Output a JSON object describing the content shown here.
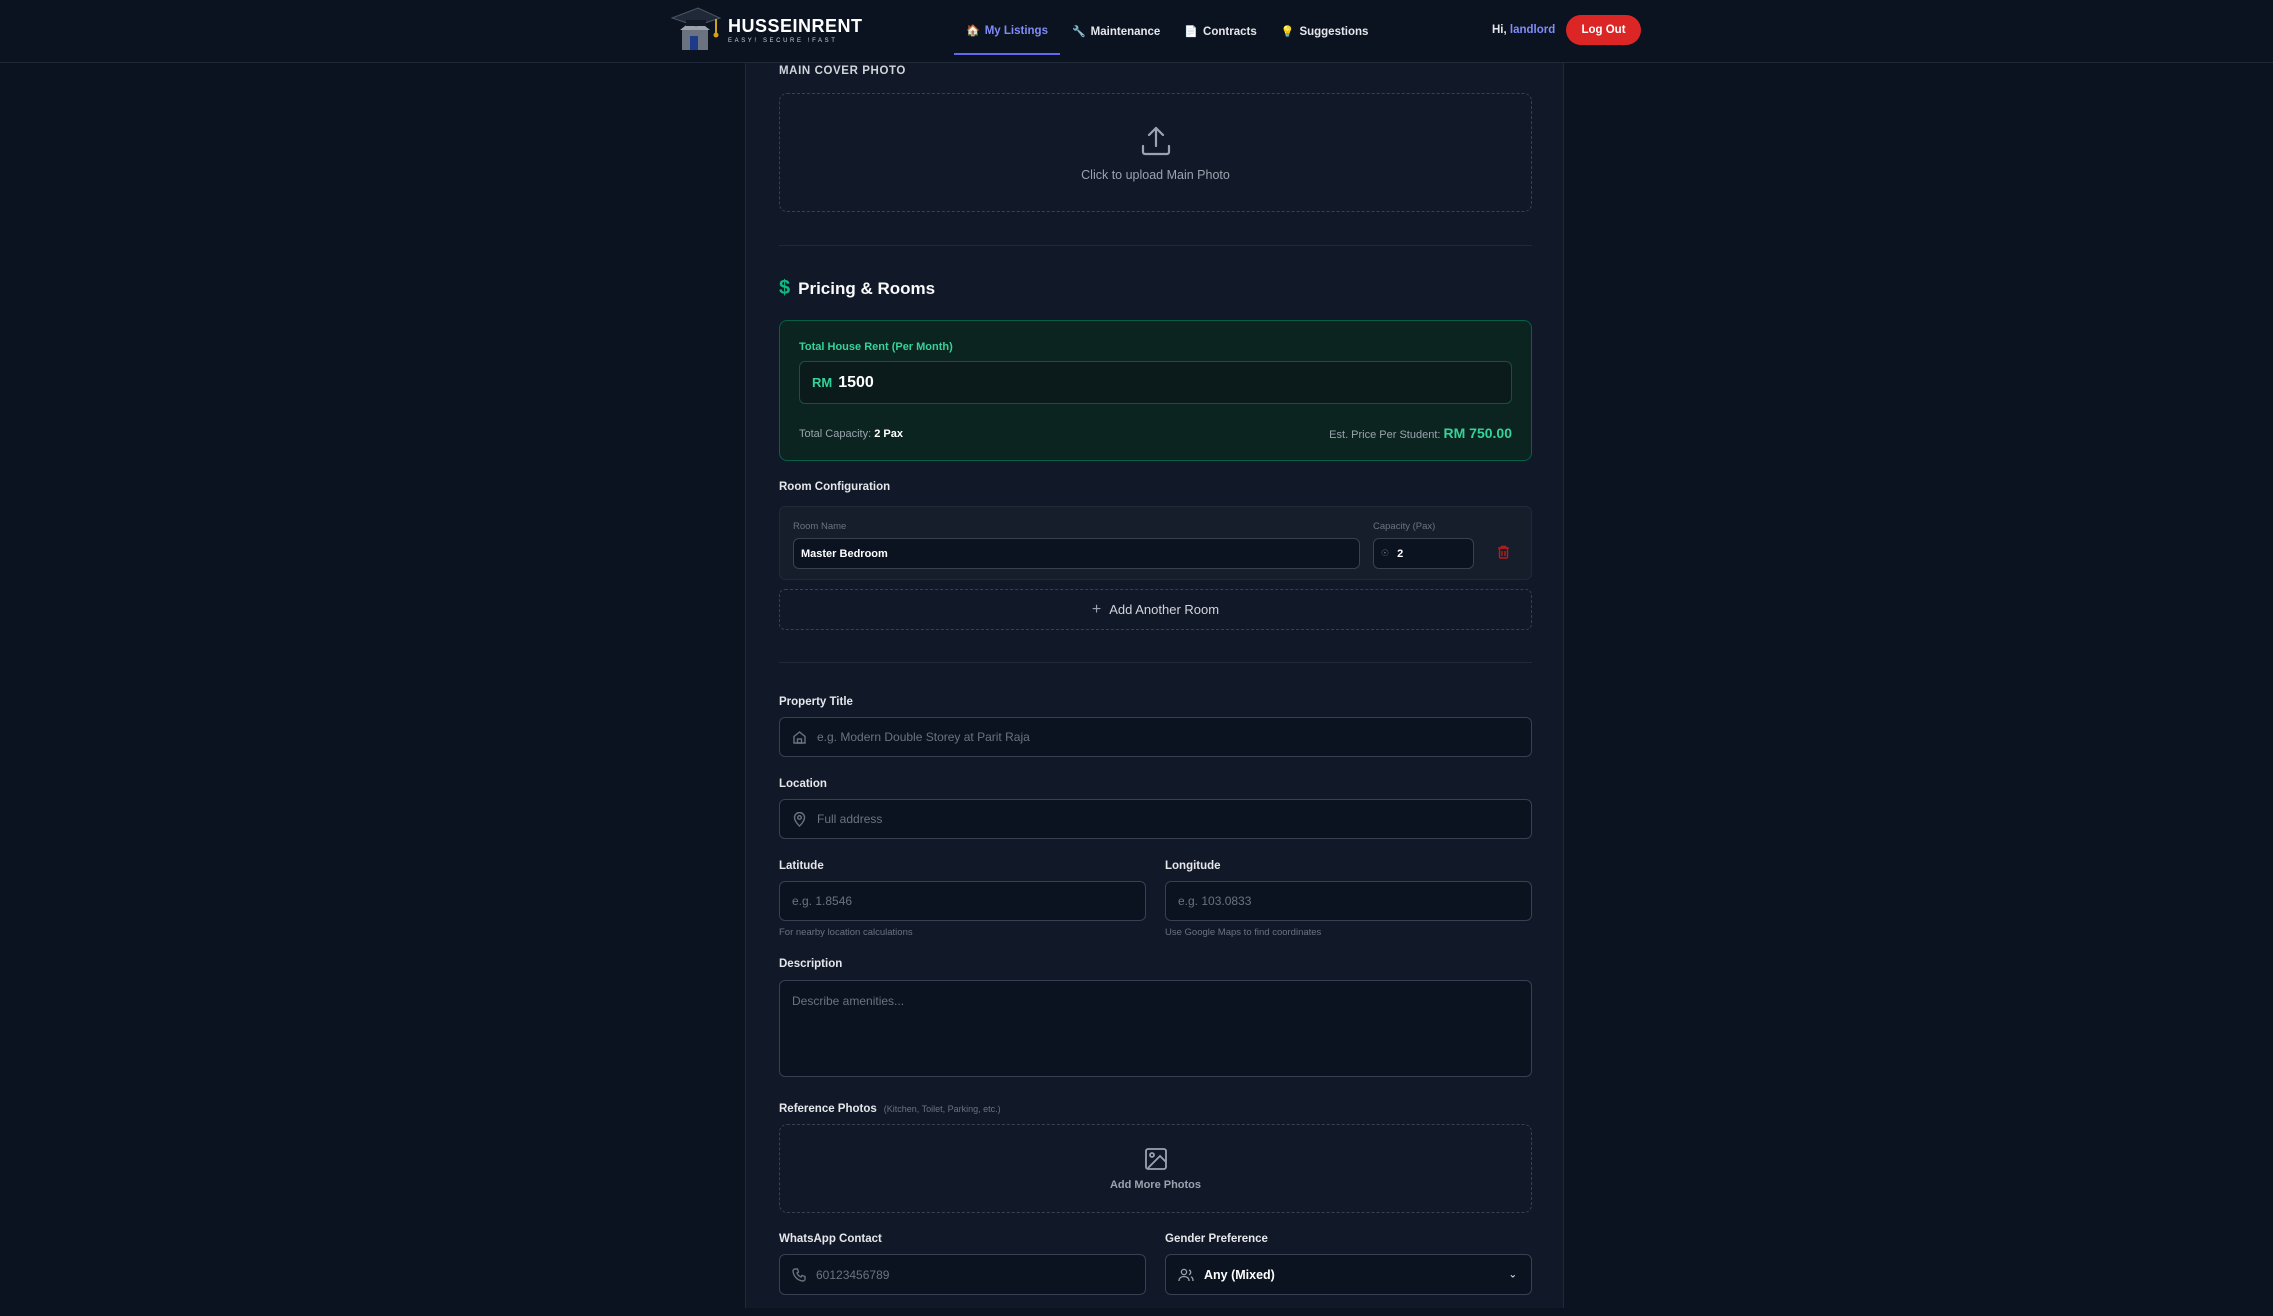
{
  "brand": {
    "name": "HUSSEINRENT",
    "tagline": "EASY! SECURE !FAST"
  },
  "nav": {
    "items": [
      {
        "label": "My Listings",
        "icon": "house-icon",
        "glyph": "🏠",
        "active": true
      },
      {
        "label": "Maintenance",
        "icon": "wrench-icon",
        "glyph": "🔧",
        "active": false
      },
      {
        "label": "Contracts",
        "icon": "document-icon",
        "glyph": "📄",
        "active": false
      },
      {
        "label": "Suggestions",
        "icon": "lightbulb-icon",
        "glyph": "💡",
        "active": false
      }
    ],
    "greeting": "Hi,",
    "username": "landlord",
    "logout_label": "Log Out"
  },
  "main_photo": {
    "section_label": "MAIN COVER PHOTO",
    "upload_text": "Click to upload Main Photo"
  },
  "pricing": {
    "title": "Pricing & Rooms",
    "rent_label": "Total House Rent (Per Month)",
    "currency": "RM",
    "rent_value": "1500",
    "capacity_label": "Total Capacity:",
    "capacity_value": "2 Pax",
    "est_label": "Est. Price Per Student:",
    "est_value": "RM 750.00"
  },
  "rooms": {
    "section_label": "Room Configuration",
    "name_label": "Room Name",
    "capacity_label": "Capacity (Pax)",
    "items": [
      {
        "name": "Master Bedroom",
        "capacity": "2"
      }
    ],
    "add_label": "Add Another Room"
  },
  "form": {
    "title_label": "Property Title",
    "title_placeholder": "e.g. Modern Double Storey at Parit Raja",
    "location_label": "Location",
    "location_placeholder": "Full address",
    "latitude_label": "Latitude",
    "latitude_placeholder": "e.g. 1.8546",
    "latitude_hint": "For nearby location calculations",
    "longitude_label": "Longitude",
    "longitude_placeholder": "e.g. 103.0833",
    "longitude_hint": "Use Google Maps to find coordinates",
    "description_label": "Description",
    "description_placeholder": "Describe amenities...",
    "ref_photos_label": "Reference Photos",
    "ref_photos_hint": "(Kitchen, Toilet, Parking, etc.)",
    "ref_photos_button": "Add More Photos",
    "whatsapp_label": "WhatsApp Contact",
    "whatsapp_placeholder": "60123456789",
    "gender_label": "Gender Preference",
    "gender_value": "Any (Mixed)"
  },
  "colors": {
    "accent": "#6366f1",
    "success": "#10b981",
    "danger": "#dc2626",
    "background": "#0b1220"
  }
}
